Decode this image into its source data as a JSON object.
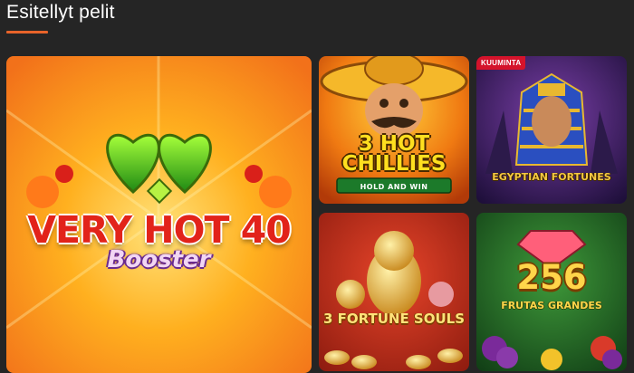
{
  "section": {
    "title": "Esitellyt pelit"
  },
  "games": {
    "very_hot": {
      "title": "VERY HOT 40",
      "subtitle": "Booster"
    },
    "chillies": {
      "title": "3 HOT CHILLIES",
      "subtitle": "HOLD AND WIN"
    },
    "egypt": {
      "badge": "KUUMINTA",
      "title": "EGYPTIAN FORTUNES"
    },
    "fortune": {
      "title": "3 FORTUNE SOULS"
    },
    "frutas": {
      "title": "256",
      "subtitle": "FRUTAS GRANDES"
    }
  },
  "colors": {
    "accent": "#e8632a",
    "badge": "#d4132b",
    "background": "#252525"
  }
}
